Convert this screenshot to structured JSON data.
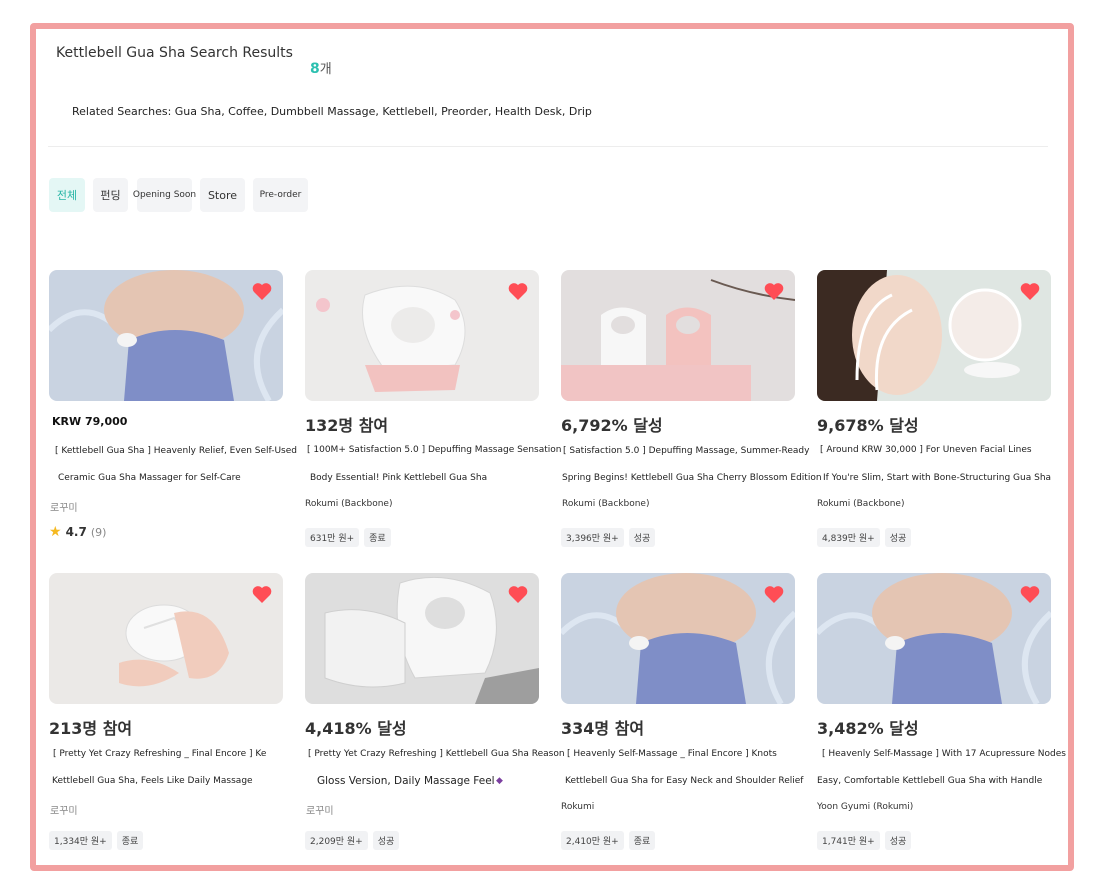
{
  "header": {
    "title": "Kettlebell Gua Sha Search Results",
    "count_value": "8",
    "count_unit": "개",
    "related": "Related Searches: Gua Sha, Coffee, Dumbbell Massage, Kettlebell, Preorder, Health Desk, Drip"
  },
  "filters": [
    {
      "label": "전체",
      "active": true
    },
    {
      "label": "펀딩",
      "active": false
    },
    {
      "label": "Opening Soon",
      "active": false
    },
    {
      "label": "Store",
      "active": false
    },
    {
      "label": "Pre-order",
      "active": false
    }
  ],
  "products": [
    {
      "headline": "KRW 79,000",
      "line1": "[ Kettlebell Gua Sha ] Heavenly Relief, Even Self-Used",
      "line2": "Ceramic Gua Sha Massager for Self-Care",
      "maker": "로꾸미",
      "rating": "4.7",
      "reviews": "(9)",
      "tags": []
    },
    {
      "headline": "132명 참여",
      "line1": "[ 100M+ Satisfaction 5.0 ] Depuffing Massage Sensation",
      "line2": "Body Essential! Pink Kettlebell Gua Sha",
      "maker": "Rokumi (Backbone)",
      "tags": [
        "631만 원+",
        "종료"
      ]
    },
    {
      "headline": "6,792% 달성",
      "line1": "[ Satisfaction 5.0 ] Depuffing Massage, Summer-Ready",
      "line2": "Spring Begins! Kettlebell Gua Sha Cherry Blossom Edition",
      "maker": "Rokumi (Backbone)",
      "tags": [
        "3,396만 원+",
        "성공"
      ]
    },
    {
      "headline": "9,678% 달성",
      "line1": "[ Around KRW 30,000 ] For Uneven Facial Lines",
      "line2": "If You're Slim, Start with Bone-Structuring Gua Sha",
      "maker": "Rokumi (Backbone)",
      "tags": [
        "4,839만 원+",
        "성공"
      ]
    },
    {
      "headline": "213명 참여",
      "line1": "[ Pretty Yet Crazy Refreshing _ Final Encore ] Ke",
      "line2": "Kettlebell Gua Sha, Feels Like Daily Massage",
      "maker": "로꾸미",
      "tags": [
        "1,334만 원+",
        "종료"
      ]
    },
    {
      "headline": "4,418% 달성",
      "line1": "[ Pretty Yet Crazy Refreshing ] Kettlebell Gua Sha Reason",
      "line2": "Gloss Version, Daily Massage Feel",
      "maker": "로꾸미",
      "tags": [
        "2,209만 원+",
        "성공"
      ]
    },
    {
      "headline": "334명 참여",
      "line1": "[ Heavenly Self-Massage _ Final Encore ] Knots",
      "line2": "Kettlebell Gua Sha for Easy Neck and Shoulder Relief",
      "maker": "Rokumi",
      "tags": [
        "2,410만 원+",
        "종료"
      ]
    },
    {
      "headline": "3,482% 달성",
      "line1": "[ Heavenly Self-Massage ] With 17 Acupressure Nodes",
      "line2": "Easy, Comfortable Kettlebell Gua Sha with Handle",
      "maker": "Yoon Gyumi (Rokumi)",
      "tags": [
        "1,741만 원+",
        "성공"
      ]
    }
  ],
  "colors": {
    "frame": "#f2a0a0",
    "accent": "#2cc0b0",
    "heart": "#ff4d55",
    "star": "#f5b921"
  }
}
